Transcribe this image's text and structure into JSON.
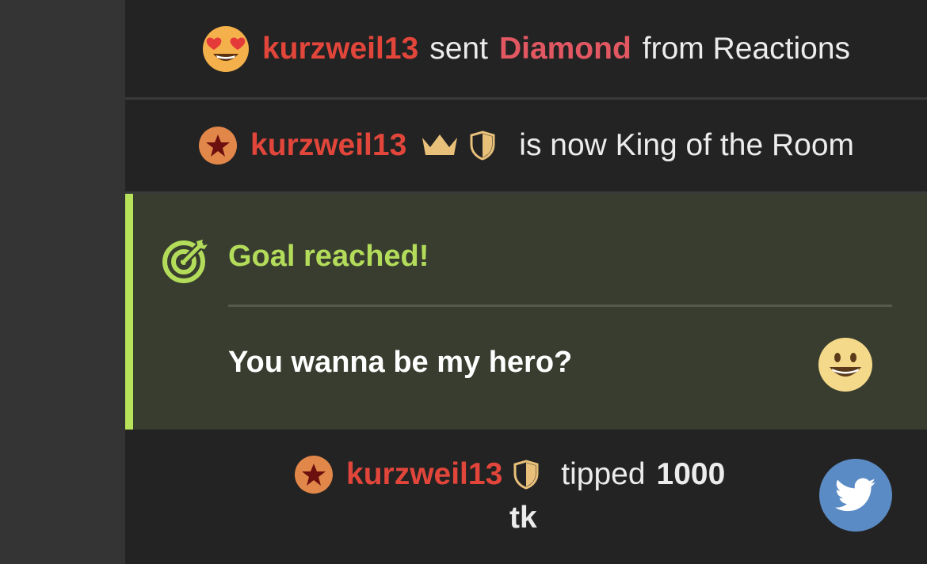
{
  "feed": {
    "reaction_event": {
      "username": "kurzweil13",
      "verb": "sent",
      "gift_name": "Diamond",
      "suffix": "from Reactions",
      "emoji_icon": "heart-eyes-emoji-icon"
    },
    "king_event": {
      "username": "kurzweil13",
      "message": "is now King of the Room",
      "badge_icon": "star-badge-icon",
      "crown_icon": "crown-icon",
      "shield_icon": "shield-icon"
    },
    "goal_event": {
      "title": "Goal reached!",
      "message": "You wanna be my hero?",
      "goal_icon": "target-icon",
      "emoji_icon": "grinning-face-emoji-icon",
      "accent_color": "#b8e25a"
    },
    "tip_event": {
      "username": "kurzweil13",
      "verb": "tipped",
      "amount": "1000",
      "unit": "tk",
      "badge_icon": "star-badge-icon",
      "shield_icon": "shield-icon",
      "share_icon": "twitter-icon"
    }
  },
  "colors": {
    "username": "#e2463b",
    "gift": "#e25862",
    "goal_text": "#b3dc5a",
    "twitter": "#5b8bc5"
  }
}
